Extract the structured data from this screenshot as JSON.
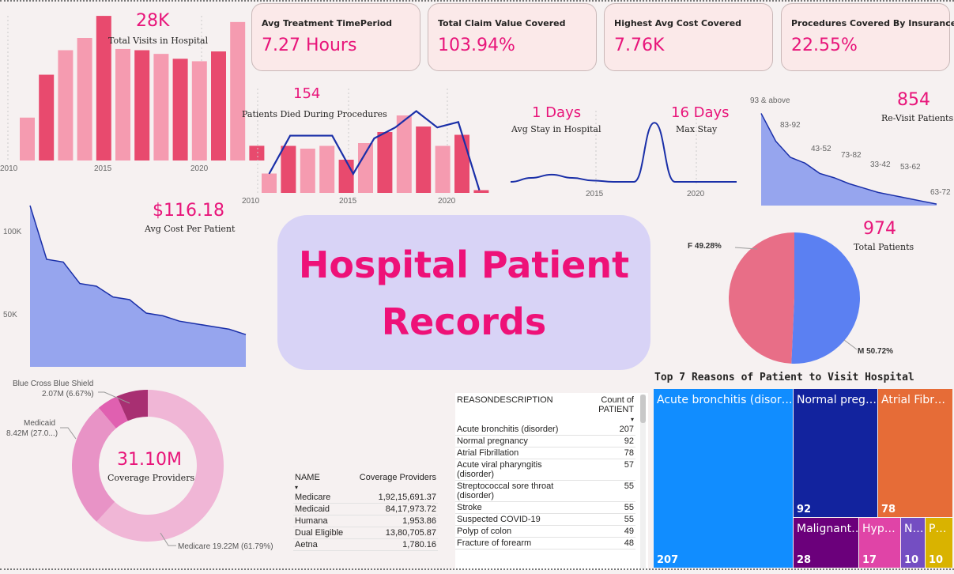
{
  "title": {
    "line1": "Hospital Patient",
    "line2": "Records"
  },
  "kpis": [
    {
      "label": "Avg Treatment TimePeriod",
      "value": "7.27 Hours"
    },
    {
      "label": "Total Claim Value Covered",
      "value": "103.94%"
    },
    {
      "label": "Highest Avg Cost Covered",
      "value": "7.76K"
    },
    {
      "label": "Procedures Covered By Insurance",
      "value": "22.55%"
    }
  ],
  "visits": {
    "value": "28K",
    "label": "Total Visits in Hospital",
    "ticks": [
      "2010",
      "2015",
      "2020"
    ]
  },
  "died": {
    "value": "154",
    "label": "Patients Died During Procedures",
    "ticks": [
      "2010",
      "2015",
      "2020"
    ]
  },
  "stay": {
    "avg_value": "1 Days",
    "avg_label": "Avg Stay in Hospital",
    "max_value": "16 Days",
    "max_label": "Max Stay",
    "ticks": [
      "2015",
      "2020"
    ]
  },
  "revisit": {
    "value": "854",
    "label": "Re-Visit Patients",
    "age_labels": [
      "93 & above",
      "83-92",
      "43-52",
      "73-82",
      "33-42",
      "53-62",
      "63-72"
    ]
  },
  "cost": {
    "value": "$116.18",
    "label": "Avg Cost Per Patient",
    "ticks": [
      "100K",
      "50K"
    ]
  },
  "patients": {
    "value": "974",
    "label": "Total Patients",
    "f_label": "F 49.28%",
    "m_label": "M 50.72%"
  },
  "coverage_donut": {
    "value": "31.10M",
    "label": "Coverage Providers",
    "labels": [
      "Blue Cross Blue Shield",
      "2.07M (6.67%)",
      "Medicaid",
      "8.42M (27.0...)",
      "Medicare 19.22M (61.79%)"
    ]
  },
  "coverage_table": {
    "headers": [
      "NAME",
      "Coverage Providers"
    ],
    "rows": [
      [
        "Medicare",
        "1,92,15,691.37"
      ],
      [
        "Medicaid",
        "84,17,973.72"
      ],
      [
        "Humana",
        "1,953.86"
      ],
      [
        "Dual Eligible",
        "13,80,705.87"
      ],
      [
        "Aetna",
        "1,780.16"
      ]
    ]
  },
  "reason_table": {
    "headers": [
      "REASONDESCRIPTION",
      "Count of PATIENT"
    ],
    "rows": [
      [
        "Acute bronchitis (disorder)",
        "207"
      ],
      [
        "Normal pregnancy",
        "92"
      ],
      [
        "Atrial Fibrillation",
        "78"
      ],
      [
        "Acute viral pharyngitis (disorder)",
        "57"
      ],
      [
        "Streptococcal sore throat (disorder)",
        "55"
      ],
      [
        "Stroke",
        "55"
      ],
      [
        "Suspected COVID-19",
        "55"
      ],
      [
        "Polyp of colon",
        "49"
      ],
      [
        "Fracture of forearm",
        "48"
      ]
    ]
  },
  "treemap": {
    "title": "Top 7 Reasons of Patient to Visit Hospital",
    "cells": [
      {
        "label": "Acute bronchitis (disor…",
        "value": "207",
        "color": "#118dff"
      },
      {
        "label": "Normal preg…",
        "value": "92",
        "color": "#12239e"
      },
      {
        "label": "Atrial Fibr…",
        "value": "78",
        "color": "#e66c37"
      },
      {
        "label": "Malignant…",
        "value": "28",
        "color": "#6b007b"
      },
      {
        "label": "Hyp…",
        "value": "17",
        "color": "#e044a7"
      },
      {
        "label": "N…",
        "value": "10",
        "color": "#744ec2"
      },
      {
        "label": "P…",
        "value": "10",
        "color": "#d9b300"
      }
    ]
  },
  "chart_data": [
    {
      "type": "bar",
      "name": "visits",
      "values": [
        35,
        70,
        90,
        100,
        118,
        91,
        90,
        87,
        83,
        81,
        89,
        113,
        12
      ],
      "colors": [
        "#f59bb0",
        "#e84a6e",
        "#f59bb0",
        "#f59bb0",
        "#e84a6e",
        "#f59bb0",
        "#e84a6e",
        "#f59bb0",
        "#e84a6e",
        "#f59bb0",
        "#e84a6e",
        "#f59bb0",
        "#e84a6e"
      ]
    },
    {
      "type": "bar",
      "name": "died_bars",
      "values": [
        7,
        17,
        16,
        17,
        12,
        18,
        22,
        28,
        24,
        17,
        21,
        1
      ],
      "line": [
        7,
        21,
        21,
        21,
        7,
        20,
        24,
        30,
        24,
        26,
        1
      ],
      "colors": [
        "#f59bb0",
        "#e84a6e",
        "#f59bb0",
        "#f59bb0",
        "#e84a6e",
        "#f59bb0",
        "#e84a6e",
        "#f59bb0",
        "#e84a6e",
        "#f59bb0",
        "#e84a6e",
        "#e84a6e"
      ]
    },
    {
      "type": "line",
      "name": "stay_distribution",
      "ylim": [
        0,
        10
      ],
      "values": [
        0,
        0.6,
        1.1,
        0.6,
        0.2,
        0,
        0,
        9,
        0,
        0,
        0,
        0
      ]
    },
    {
      "type": "area",
      "name": "revisit_by_age",
      "values": [
        63,
        44,
        33,
        29,
        22,
        19,
        15,
        12,
        9,
        7,
        5,
        3,
        1
      ]
    },
    {
      "type": "area",
      "name": "cost_per_patient",
      "values": [
        120,
        80,
        78,
        62,
        60,
        52,
        50,
        40,
        38,
        34,
        32,
        30,
        28,
        24
      ]
    },
    {
      "type": "pie",
      "name": "gender",
      "slices": [
        {
          "label": "F",
          "value": 49.28,
          "color": "#e86e87"
        },
        {
          "label": "M",
          "value": 50.72,
          "color": "#5b80f2"
        }
      ]
    },
    {
      "type": "pie",
      "name": "coverage",
      "slices": [
        {
          "label": "Medicare",
          "value": 61.79,
          "color": "#f0b6d6"
        },
        {
          "label": "Medicaid",
          "value": 27.0,
          "color": "#e893c6"
        },
        {
          "label": "Other",
          "value": 4.54,
          "color": "#e060b0"
        },
        {
          "label": "Blue Cross Blue Shield",
          "value": 6.67,
          "color": "#a82f72"
        }
      ]
    }
  ]
}
